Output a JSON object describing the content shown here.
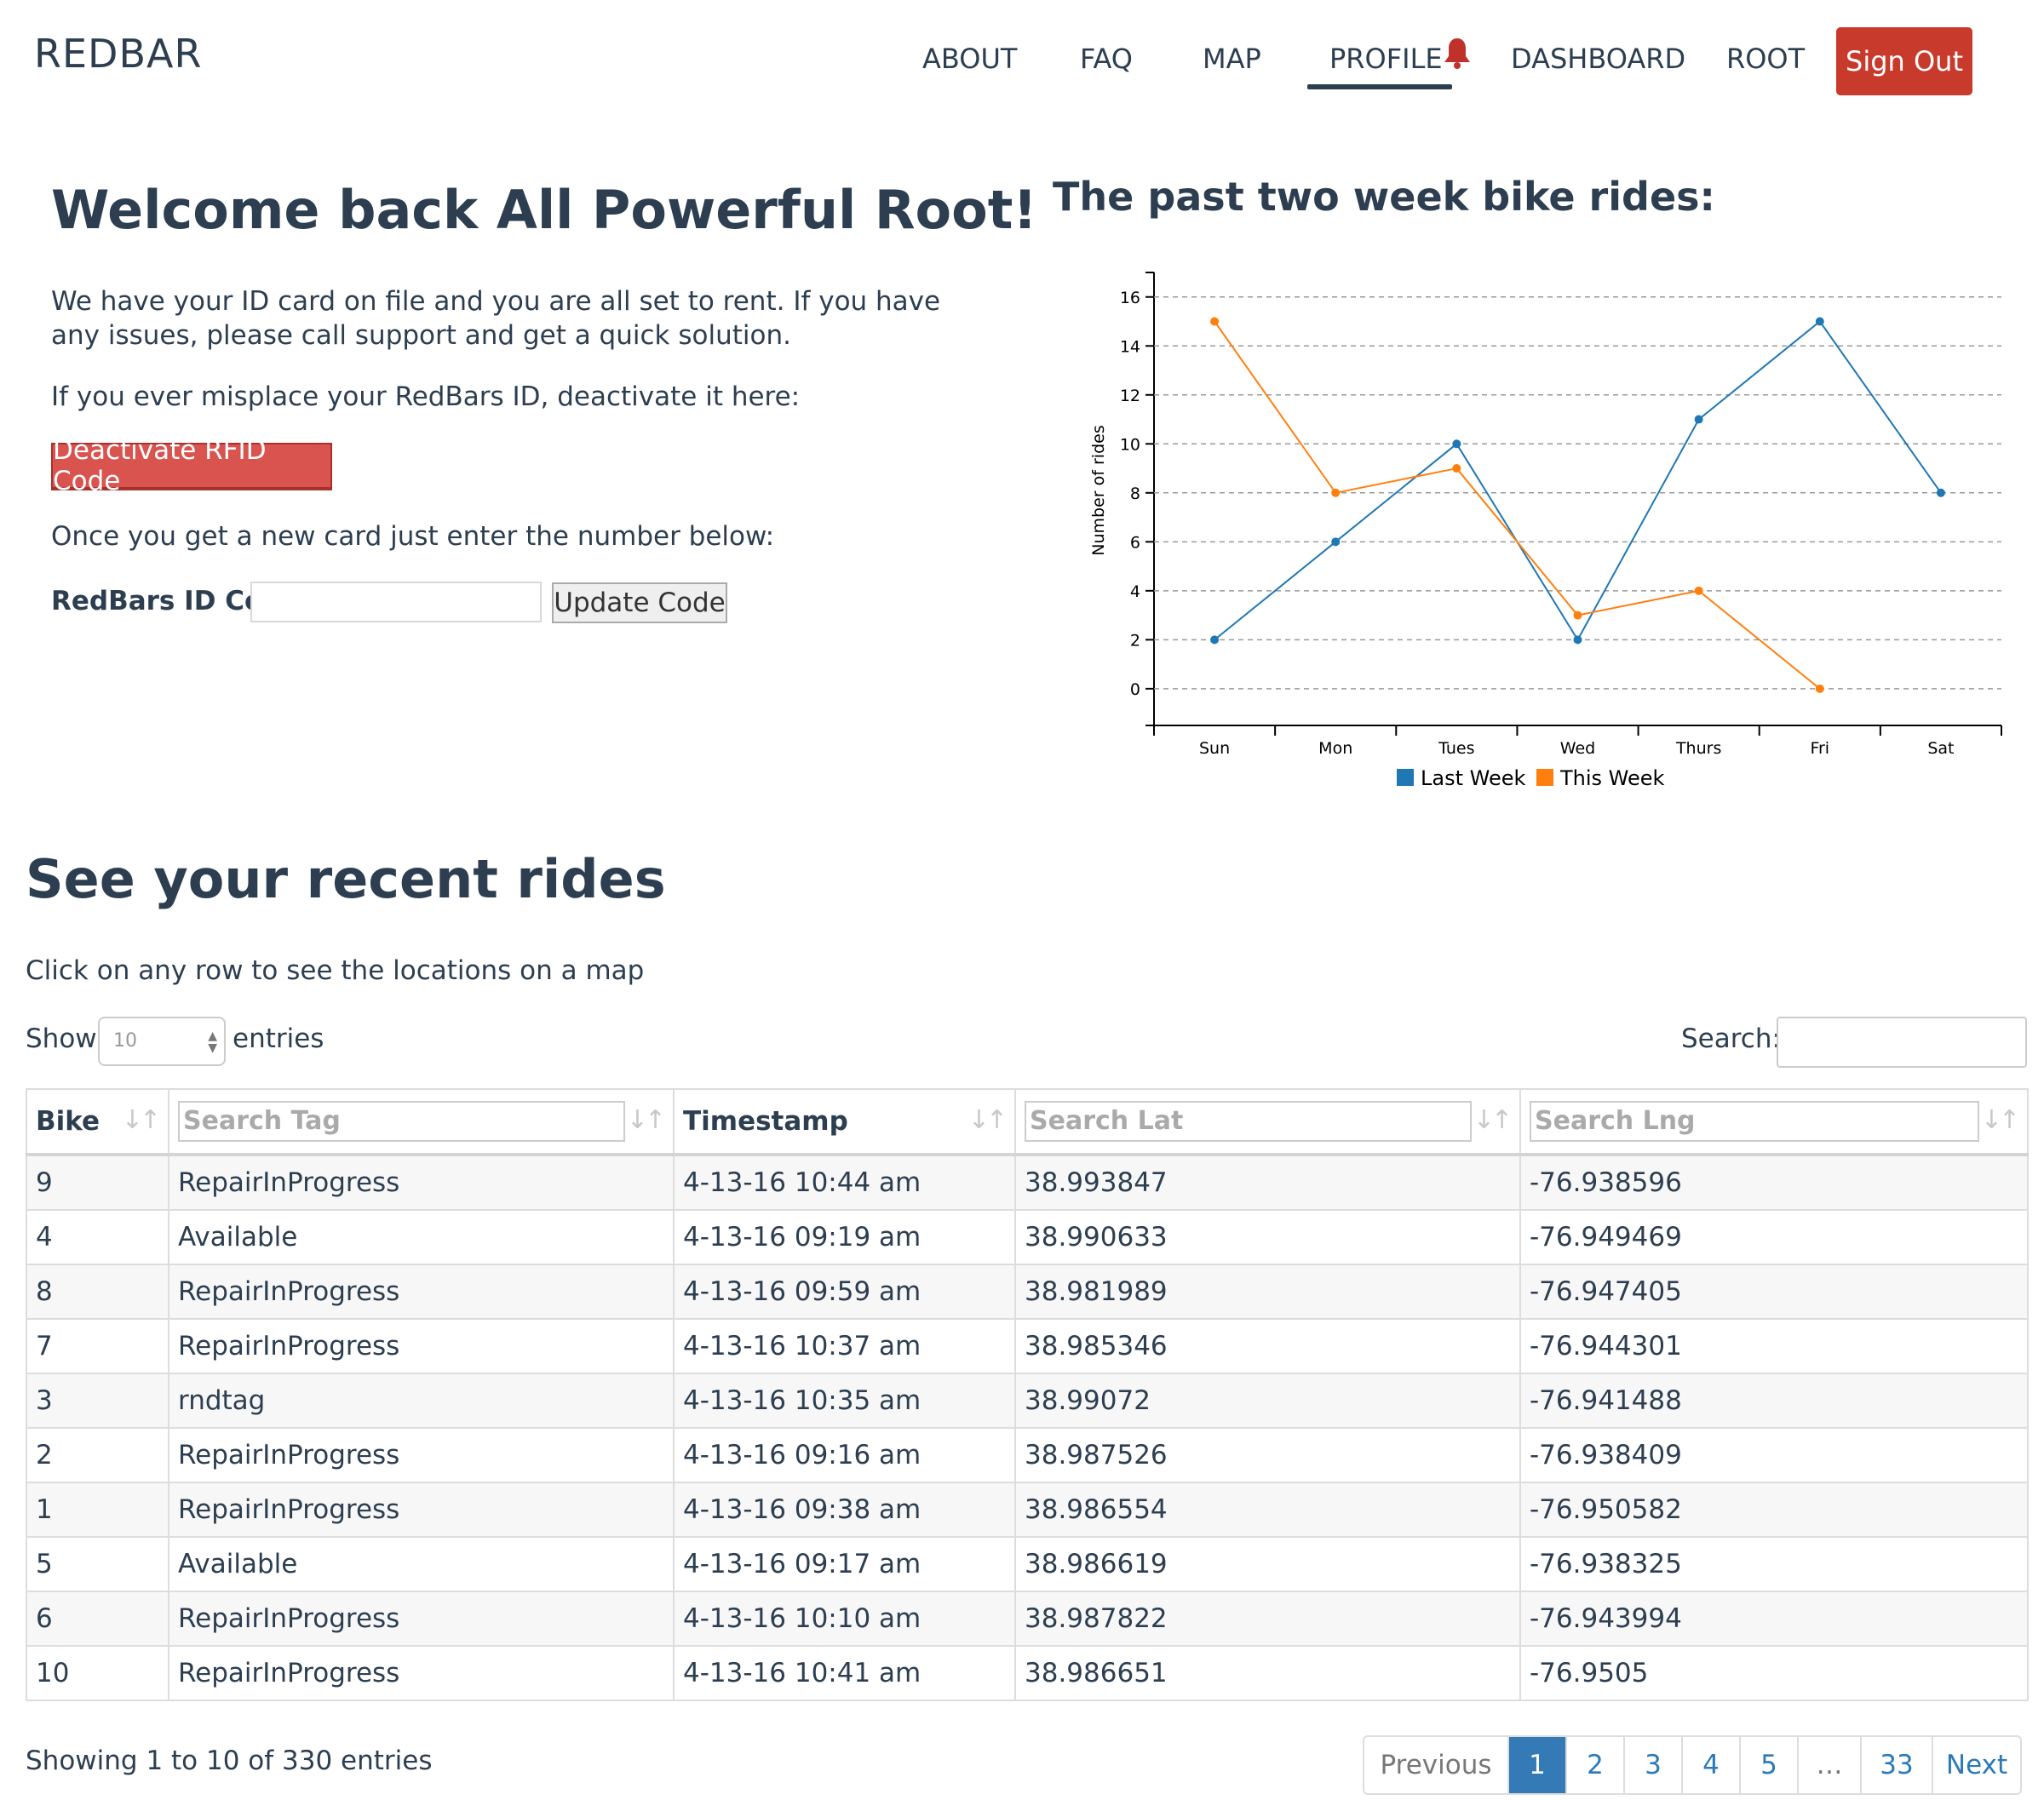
{
  "nav": {
    "brand": "REDBAR",
    "links": [
      "ABOUT",
      "FAQ",
      "MAP",
      "PROFILE",
      "DASHBOARD",
      "ROOT"
    ],
    "active": "PROFILE",
    "signout": "Sign Out",
    "accent": "#c83a2c"
  },
  "welcome": {
    "title": "Welcome back All Powerful Root!",
    "p1": "We have your ID card on file and you are all set to rent. If you have any issues, please call support and get a quick solution.",
    "p2": "If you ever misplace your RedBars ID, deactivate it here:",
    "deactivate_label": "Deactivate RFID Code",
    "p3": "Once you get a new card just enter the number below:",
    "id_label": "RedBars ID Code",
    "id_value": "",
    "update_label": "Update Code"
  },
  "chart": {
    "title": "The past two week bike rides:"
  },
  "chart_data": {
    "type": "line",
    "categories": [
      "Sun",
      "Mon",
      "Tues",
      "Wed",
      "Thurs",
      "Fri",
      "Sat"
    ],
    "series": [
      {
        "name": "Last Week",
        "color": "#1f77b4",
        "values": [
          2,
          6,
          10,
          2,
          11,
          15,
          8
        ]
      },
      {
        "name": "This Week",
        "color": "#ff7f0e",
        "values": [
          15,
          8,
          9,
          3,
          4,
          0,
          null
        ]
      }
    ],
    "ylabel": "Number of rides",
    "yticks": [
      0,
      2,
      4,
      6,
      8,
      10,
      12,
      14,
      16
    ],
    "ylim": [
      -1.5,
      17
    ],
    "grid": true,
    "legend": "bottom"
  },
  "rides": {
    "title": "See your recent rides",
    "subtitle": "Click on any row to see the locations on a map",
    "show_label": "Show",
    "show_value": "10",
    "entries_label": "entries",
    "search_label": "Search:",
    "columns": [
      {
        "label": "Bike",
        "type": "text"
      },
      {
        "label": "Search Tag",
        "type": "input"
      },
      {
        "label": "Timestamp",
        "type": "text"
      },
      {
        "label": "Search Lat",
        "type": "input"
      },
      {
        "label": "Search Lng",
        "type": "input"
      }
    ],
    "rows": [
      [
        "9",
        "RepairInProgress",
        "4-13-16 10:44 am",
        "38.993847",
        "-76.938596"
      ],
      [
        "4",
        "Available",
        "4-13-16 09:19 am",
        "38.990633",
        "-76.949469"
      ],
      [
        "8",
        "RepairInProgress",
        "4-13-16 09:59 am",
        "38.981989",
        "-76.947405"
      ],
      [
        "7",
        "RepairInProgress",
        "4-13-16 10:37 am",
        "38.985346",
        "-76.944301"
      ],
      [
        "3",
        "rndtag",
        "4-13-16 10:35 am",
        "38.99072",
        "-76.941488"
      ],
      [
        "2",
        "RepairInProgress",
        "4-13-16 09:16 am",
        "38.987526",
        "-76.938409"
      ],
      [
        "1",
        "RepairInProgress",
        "4-13-16 09:38 am",
        "38.986554",
        "-76.950582"
      ],
      [
        "5",
        "Available",
        "4-13-16 09:17 am",
        "38.986619",
        "-76.938325"
      ],
      [
        "6",
        "RepairInProgress",
        "4-13-16 10:10 am",
        "38.987822",
        "-76.943994"
      ],
      [
        "10",
        "RepairInProgress",
        "4-13-16 10:41 am",
        "38.986651",
        "-76.9505"
      ]
    ],
    "showing": "Showing 1 to 10 of 330 entries",
    "pagination": [
      "Previous",
      "1",
      "2",
      "3",
      "4",
      "5",
      "…",
      "33",
      "Next"
    ],
    "active_page": "1"
  }
}
